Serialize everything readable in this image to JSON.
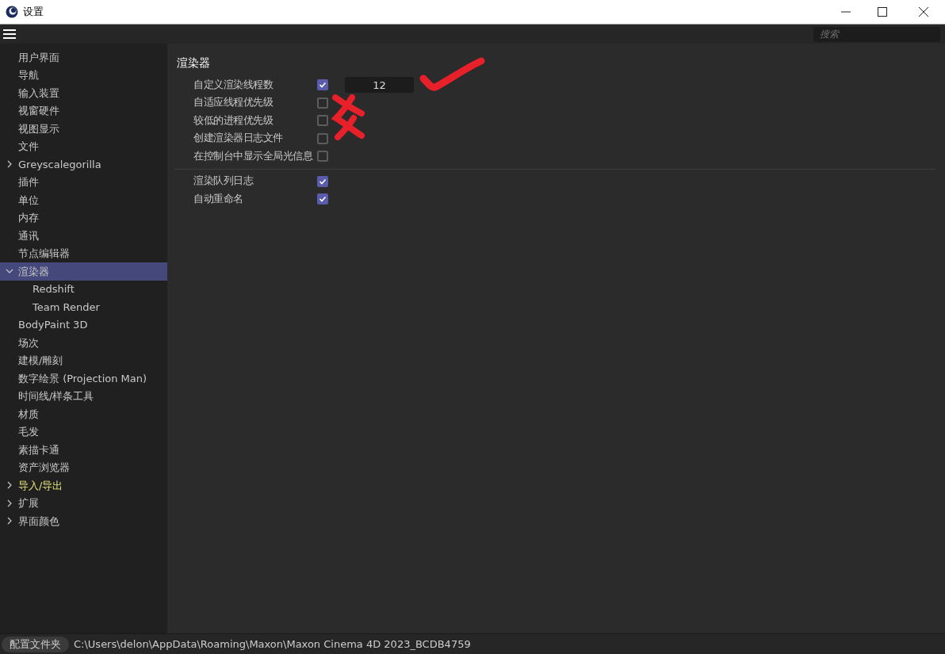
{
  "window": {
    "title": "设置"
  },
  "search": {
    "placeholder": "搜索"
  },
  "sidebar": {
    "items": [
      {
        "label": "用户界面",
        "selected": false,
        "highlighted": false
      },
      {
        "label": "导航",
        "selected": false,
        "highlighted": false
      },
      {
        "label": "输入装置",
        "selected": false,
        "highlighted": false
      },
      {
        "label": "视窗硬件",
        "selected": false,
        "highlighted": false
      },
      {
        "label": "视图显示",
        "selected": false,
        "highlighted": false
      },
      {
        "label": "文件",
        "selected": false,
        "highlighted": false
      },
      {
        "label": "Greyscalegorilla",
        "selected": false,
        "highlighted": false,
        "expanded": false
      },
      {
        "label": "插件",
        "selected": false,
        "highlighted": false
      },
      {
        "label": "单位",
        "selected": false,
        "highlighted": false
      },
      {
        "label": "内存",
        "selected": false,
        "highlighted": false
      },
      {
        "label": "通讯",
        "selected": false,
        "highlighted": false
      },
      {
        "label": "节点编辑器",
        "selected": false,
        "highlighted": false
      },
      {
        "label": "渲染器",
        "selected": true,
        "highlighted": false,
        "expanded": true,
        "children": [
          {
            "label": "Redshift",
            "selected": false,
            "highlighted": false
          },
          {
            "label": "Team Render",
            "selected": false,
            "highlighted": false
          }
        ]
      },
      {
        "label": "BodyPaint 3D",
        "selected": false,
        "highlighted": false
      },
      {
        "label": "场次",
        "selected": false,
        "highlighted": false
      },
      {
        "label": "建模/雕刻",
        "selected": false,
        "highlighted": false
      },
      {
        "label": "数字绘景 (Projection Man)",
        "selected": false,
        "highlighted": false
      },
      {
        "label": "时间线/样条工具",
        "selected": false,
        "highlighted": false
      },
      {
        "label": "材质",
        "selected": false,
        "highlighted": false
      },
      {
        "label": "毛发",
        "selected": false,
        "highlighted": false
      },
      {
        "label": "素描卡通",
        "selected": false,
        "highlighted": false
      },
      {
        "label": "资产浏览器",
        "selected": false,
        "highlighted": false
      },
      {
        "label": "导入/导出",
        "selected": false,
        "highlighted": true,
        "expanded": false
      },
      {
        "label": "扩展",
        "selected": false,
        "highlighted": false,
        "expanded": false
      },
      {
        "label": "界面颜色",
        "selected": false,
        "highlighted": false,
        "expanded": false
      }
    ]
  },
  "panel": {
    "title": "渲染器",
    "groups": [
      {
        "rows": [
          {
            "label": "自定义渲染线程数",
            "checked": true,
            "value": "12"
          },
          {
            "label": "自适应线程优先级",
            "checked": false
          },
          {
            "label": "较低的进程优先级",
            "checked": false
          },
          {
            "label": "创建渲染器日志文件",
            "checked": false
          },
          {
            "label": "在控制台中显示全局光信息",
            "checked": false
          }
        ]
      },
      {
        "rows": [
          {
            "label": "渲染队列日志",
            "checked": true
          },
          {
            "label": "自动重命名",
            "checked": true
          }
        ]
      }
    ]
  },
  "status_bar": {
    "button": "配置文件夹",
    "path": "C:\\Users\\delon\\AppData\\Roaming\\Maxon\\Maxon Cinema 4D 2023_BCDB4759"
  }
}
